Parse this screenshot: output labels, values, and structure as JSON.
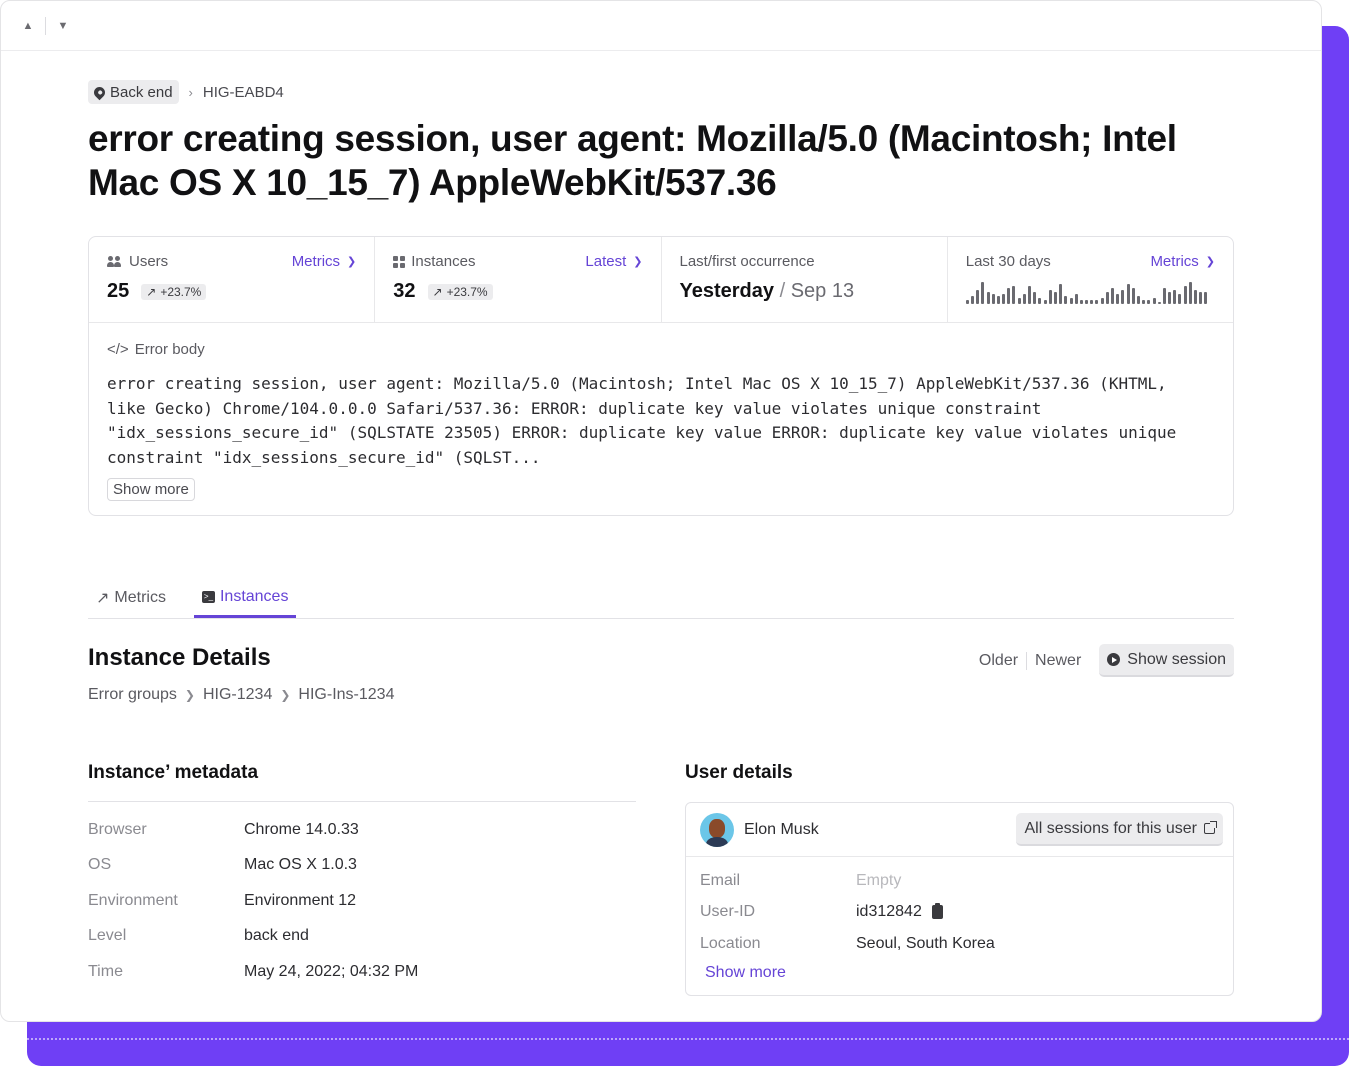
{
  "breadcrumb": {
    "tag": "Back end",
    "id": "HIG-EABD4"
  },
  "title": "error creating session, user agent: Mozilla/5.0 (Macintosh; Intel Mac OS X 10_15_7) AppleWebKit/537.36",
  "stats": {
    "users": {
      "label": "Users",
      "link": "Metrics",
      "value": "25",
      "delta": "+23.7%"
    },
    "instances": {
      "label": "Instances",
      "link": "Latest",
      "value": "32",
      "delta": "+23.7%"
    },
    "occurrence": {
      "label": "Last/first occurrence",
      "last": "Yesterday",
      "sep": "/",
      "first": "Sep 13"
    },
    "last30": {
      "label": "Last 30 days",
      "link": "Metrics",
      "bars": [
        4,
        8,
        14,
        22,
        12,
        10,
        8,
        10,
        16,
        18,
        6,
        10,
        18,
        12,
        6,
        4,
        14,
        12,
        20,
        8,
        6,
        10,
        4,
        4,
        4,
        4,
        6,
        12,
        16,
        10,
        14,
        20,
        16,
        8,
        4,
        4,
        6,
        2,
        16,
        12,
        14,
        10,
        18,
        22,
        14,
        12,
        12
      ]
    }
  },
  "error_body": {
    "label": "Error body",
    "text": "error creating session, user agent: Mozilla/5.0 (Macintosh; Intel Mac OS X 10_15_7) AppleWebKit/537.36 (KHTML,\nlike Gecko) Chrome/104.0.0.0 Safari/537.36: ERROR: duplicate key value violates unique constraint\n\"idx_sessions_secure_id\" (SQLSTATE 23505) ERROR: duplicate key value ERROR: duplicate key value violates unique\nconstraint \"idx_sessions_secure_id\" (SQLST...",
    "show_more": "Show more"
  },
  "tabs": [
    {
      "label": "Metrics"
    },
    {
      "label": "Instances"
    }
  ],
  "instance": {
    "title": "Instance Details",
    "older": "Older",
    "newer": "Newer",
    "show_session": "Show session",
    "crumbs": [
      "Error groups",
      "HIG-1234",
      "HIG-Ins-1234"
    ]
  },
  "metadata": {
    "title": "Instance’ metadata",
    "rows": [
      {
        "key": "Browser",
        "value": "Chrome 14.0.33"
      },
      {
        "key": "OS",
        "value": "Mac OS X 1.0.3"
      },
      {
        "key": "Environment",
        "value": "Environment 12"
      },
      {
        "key": "Level",
        "value": "back end"
      },
      {
        "key": "Time",
        "value": "May 24, 2022; 04:32 PM"
      }
    ]
  },
  "user": {
    "title": "User details",
    "name": "Elon Musk",
    "all_sessions": "All sessions for this user",
    "email_key": "Email",
    "email_val": "Empty",
    "userid_key": "User-ID",
    "userid_val": "id312842",
    "location_key": "Location",
    "location_val": "Seoul, South Korea",
    "show_more": "Show more"
  },
  "colors": {
    "accent": "#6544d6",
    "backdrop": "#6f3ff5"
  }
}
